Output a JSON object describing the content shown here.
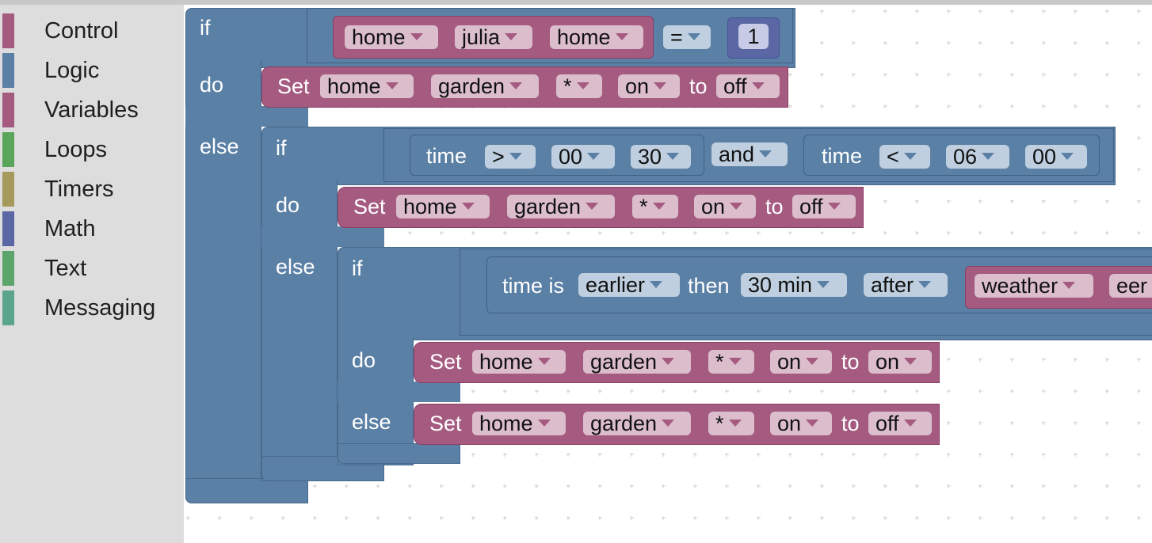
{
  "toolbox": {
    "categories": [
      {
        "label": "Control",
        "color": "#a55b80"
      },
      {
        "label": "Logic",
        "color": "#5b80a5"
      },
      {
        "label": "Variables",
        "color": "#a55b80"
      },
      {
        "label": "Loops",
        "color": "#5ba55b"
      },
      {
        "label": "Timers",
        "color": "#a5995b"
      },
      {
        "label": "Math",
        "color": "#5b67a5"
      },
      {
        "label": "Text",
        "color": "#5ba56a"
      },
      {
        "label": "Messaging",
        "color": "#5ba58c"
      }
    ]
  },
  "colors": {
    "logic": "#5b80a5",
    "variables": "#a55b80",
    "math": "#5b67a5"
  },
  "kw": {
    "if": "if",
    "do": "do",
    "else": "else",
    "set": "Set",
    "to": "to",
    "time": "time",
    "and": "and",
    "time_is": "time is",
    "then": "then"
  },
  "cond1": {
    "home": "home",
    "julia": "julia",
    "home2": "home",
    "op": "=",
    "value": "1"
  },
  "set1": {
    "loc": "home",
    "area": "garden",
    "dev": "*",
    "state": "on",
    "value": "off"
  },
  "cond2": {
    "left": {
      "op": ">",
      "h": "00",
      "m": "30"
    },
    "logic": "and",
    "right": {
      "op": "<",
      "h": "06",
      "m": "00"
    }
  },
  "set2": {
    "loc": "home",
    "area": "garden",
    "dev": "*",
    "state": "on",
    "value": "off"
  },
  "cond3": {
    "rel": "earlier",
    "offset": "30 min",
    "anchor": "after",
    "src": "weather",
    "cut": "eer"
  },
  "set3": {
    "loc": "home",
    "area": "garden",
    "dev": "*",
    "state": "on",
    "value": "on"
  },
  "set4": {
    "loc": "home",
    "area": "garden",
    "dev": "*",
    "state": "on",
    "value": "off"
  }
}
